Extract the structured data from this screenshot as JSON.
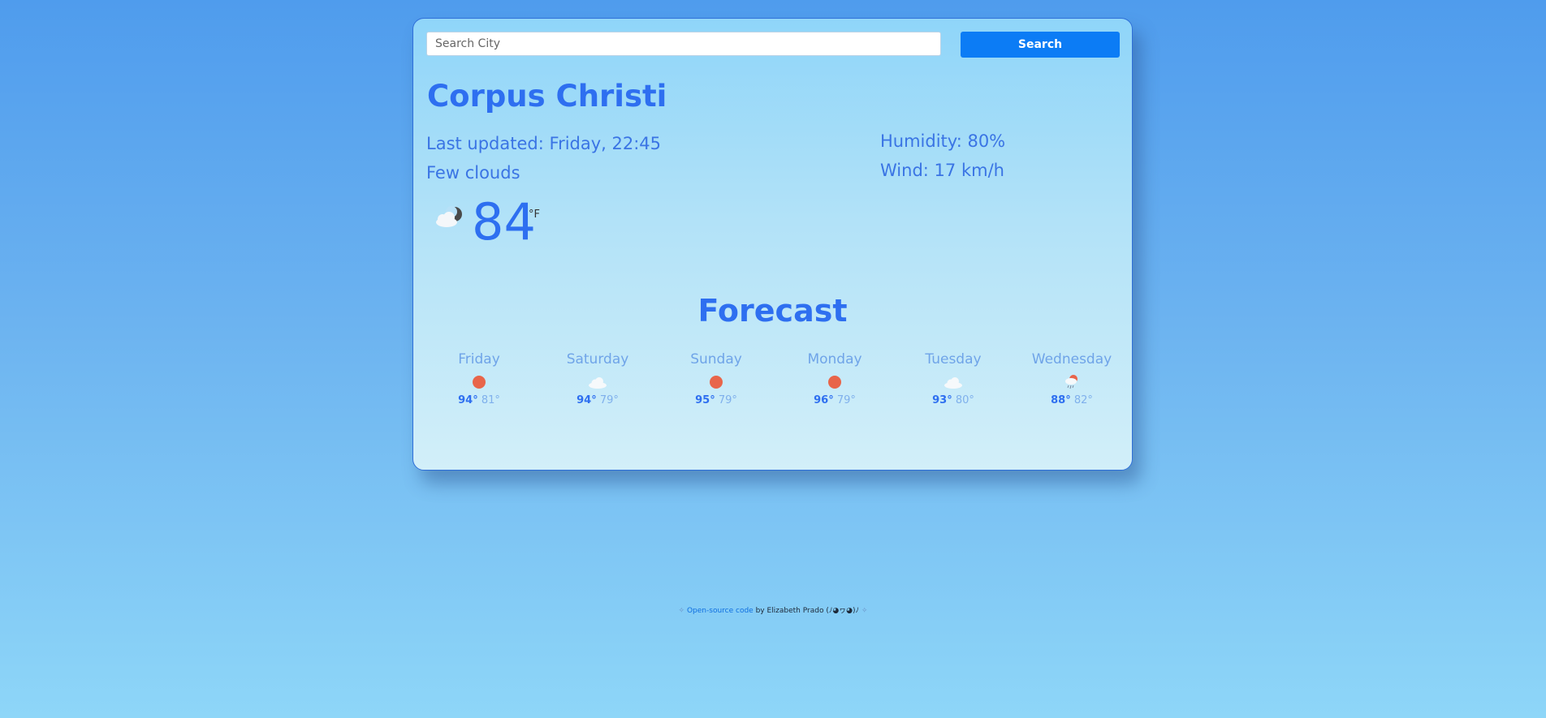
{
  "search": {
    "placeholder": "Search City",
    "button_label": "Search"
  },
  "current": {
    "city": "Corpus Christi",
    "last_updated_label": "Last updated:",
    "last_updated_value": "Friday, 22:45",
    "description": "Few clouds",
    "temperature": "84",
    "unit": "°F",
    "icon": "few-clouds-night-icon",
    "humidity_label": "Humidity:",
    "humidity_value": "80%",
    "wind_label": "Wind:",
    "wind_value": "17",
    "wind_unit": "km/h"
  },
  "forecast": {
    "title": "Forecast",
    "days": [
      {
        "day": "Friday",
        "icon": "sun-icon",
        "max": "94°",
        "min": "81°"
      },
      {
        "day": "Saturday",
        "icon": "cloud-icon",
        "max": "94°",
        "min": "79°"
      },
      {
        "day": "Sunday",
        "icon": "sun-icon",
        "max": "95°",
        "min": "79°"
      },
      {
        "day": "Monday",
        "icon": "sun-icon",
        "max": "96°",
        "min": "79°"
      },
      {
        "day": "Tuesday",
        "icon": "cloud-icon",
        "max": "93°",
        "min": "80°"
      },
      {
        "day": "Wednesday",
        "icon": "rain-sun-icon",
        "max": "88°",
        "min": "82°"
      }
    ]
  },
  "footer": {
    "star_left": "✧",
    "link_text": "Open-source code",
    "by_text": " by Elizabeth Prado (ﾉ◕ヮ◕)ﾉ ",
    "star_right": "✧"
  },
  "colors": {
    "accent_blue": "#2e6ff0",
    "button_blue": "#0c7cf5",
    "sun_orange": "#e8654a"
  }
}
